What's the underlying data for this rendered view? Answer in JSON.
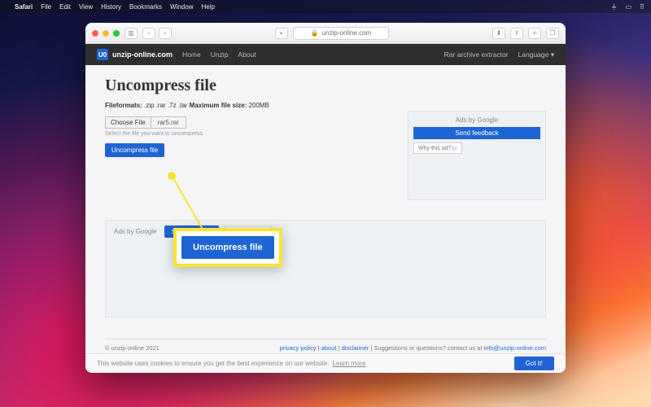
{
  "menubar": {
    "app": "Safari",
    "items": [
      "File",
      "Edit",
      "View",
      "History",
      "Bookmarks",
      "Window",
      "Help"
    ]
  },
  "browser": {
    "address_prefix": "🔒",
    "address": "unzip-online.com"
  },
  "site": {
    "brand_badge": "U0",
    "brand": "unzip-online.com",
    "nav": [
      "Home",
      "Unzip",
      "About"
    ],
    "nav_right_extractor": "Rar archive extractor",
    "nav_right_language": "Language ▾"
  },
  "main": {
    "heading": "Uncompress file",
    "formats_label": "Fileformats:",
    "formats": ".zip .rar .7z .tar",
    "maxsize_label": "Maximum file size:",
    "maxsize": "200MB",
    "choose_btn": "Choose File",
    "chosen_file": "rar5.rar",
    "hint": "Select the file you want to uncompress.",
    "submit": "Uncompress file"
  },
  "ads": {
    "header": "Ads by Google",
    "send": "Send feedback",
    "why": "Why this ad? ▷"
  },
  "callout": {
    "label": "Uncompress file"
  },
  "footer": {
    "copyright": "© unzip-online 2021",
    "links": {
      "privacy": "privacy policy",
      "about": "about",
      "disclaimer": "disclaimer"
    },
    "suggest_prefix": "Suggestions or questions? contact us at ",
    "email": "info@unzip-online.com"
  },
  "cookie": {
    "text": "This website uses cookies to ensure you get the best experience on our website.",
    "learn": "Learn more",
    "ok": "Got it!"
  }
}
